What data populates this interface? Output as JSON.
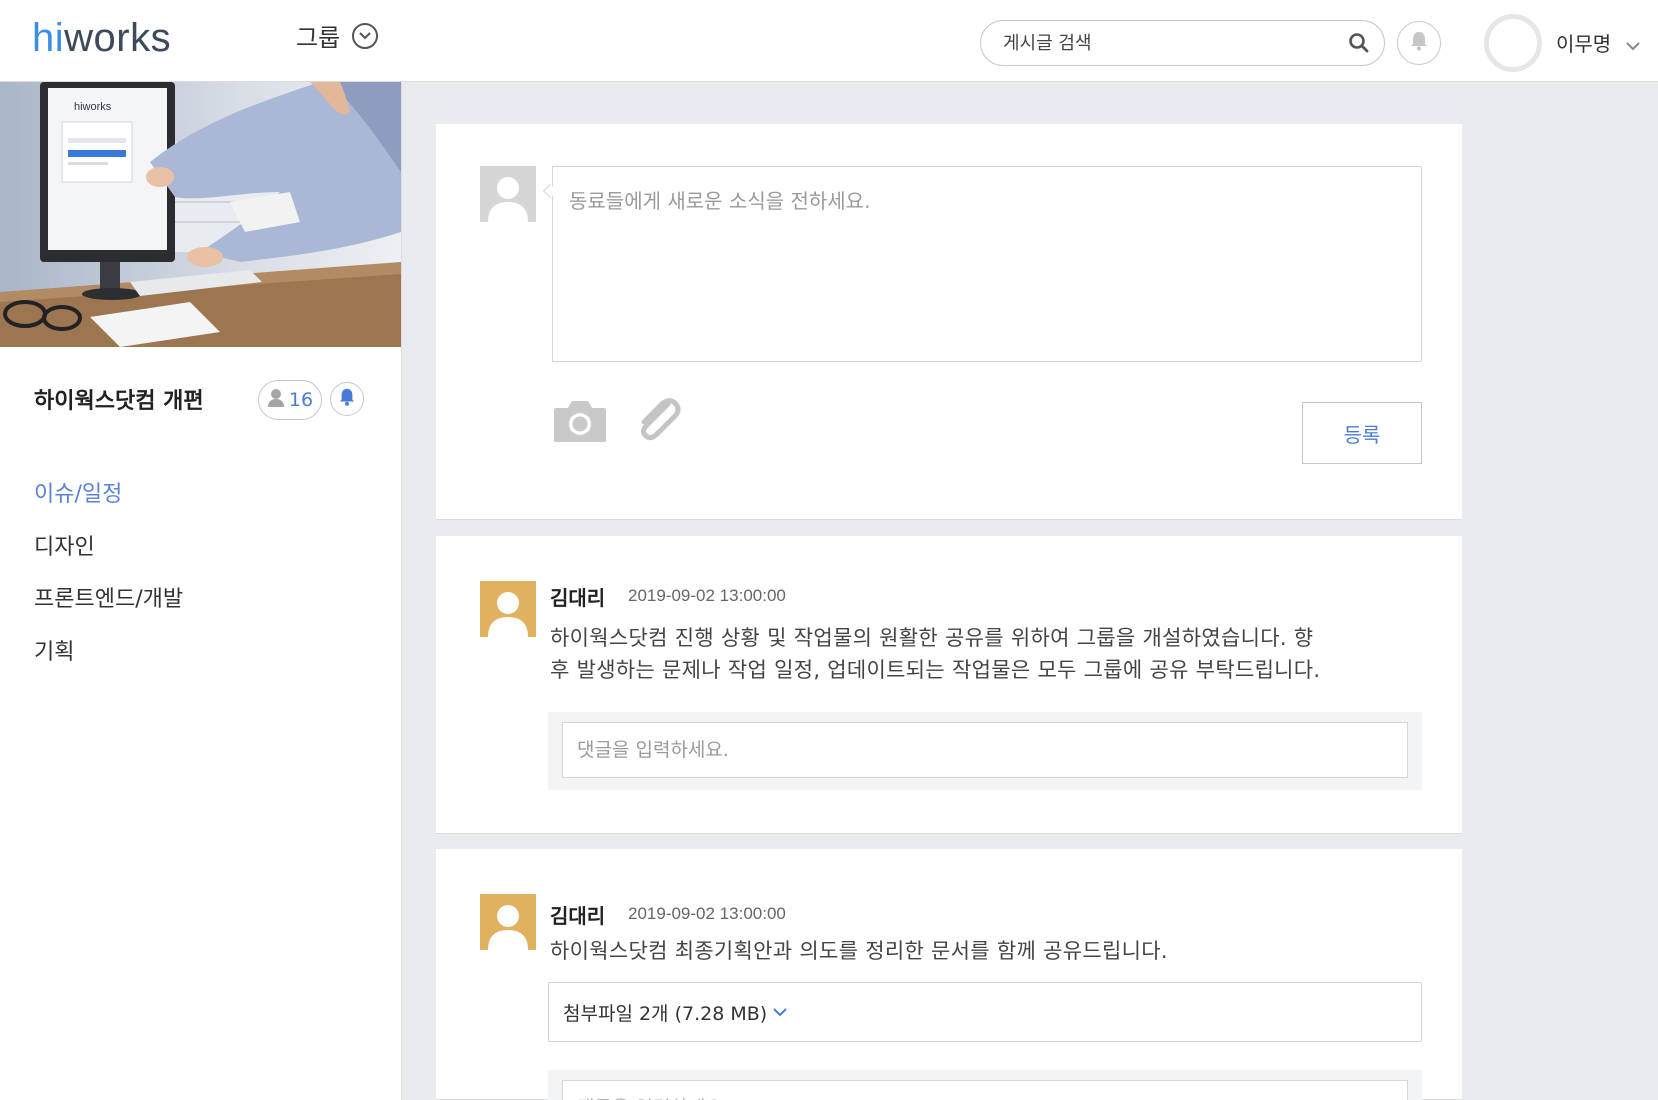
{
  "header": {
    "logo": {
      "h": "h",
      "i": "i",
      "rest": "works"
    },
    "group_menu_label": "그룹",
    "search_placeholder": "게시글 검색",
    "user_name": "이무명"
  },
  "sidebar": {
    "cover_logo": "hiworks",
    "group_title": "하이웍스닷컴 개편",
    "member_count": "16",
    "nav_items": [
      {
        "label": "이슈/일정",
        "active": true
      },
      {
        "label": "디자인",
        "active": false
      },
      {
        "label": "프론트엔드/개발",
        "active": false
      },
      {
        "label": "기획",
        "active": false
      }
    ]
  },
  "composer": {
    "placeholder": "동료들에게 새로운 소식을 전하세요.",
    "submit_label": "등록"
  },
  "posts": [
    {
      "author": "김대리",
      "time": "2019-09-02 13:00:00",
      "body_line1": "하이웍스닷컴 진행 상황 및 작업물의 원활한 공유를 위하여 그룹을 개설하였습니다. 향",
      "body_line2": "후 발생하는 문제나 작업 일정, 업데이트되는 작업물은 모두 그룹에 공유 부탁드립니다.",
      "comment_placeholder": "댓글을 입력하세요."
    },
    {
      "author": "김대리",
      "time": "2019-09-02 13:00:00",
      "body_line1": "하이웍스닷컴 최종기획안과 의도를 정리한 문서를 함께 공유드립니다.",
      "attachment_label": "첨부파일 2개 (7.28 MB)",
      "comment_placeholder": "댓글을 입력하세요."
    }
  ],
  "colors": {
    "accent": "#4a7bd8",
    "nav_active": "#5b82d8",
    "background": "#e9ebee",
    "avatar_gold": "#e0b15e"
  },
  "icons": [
    "chevron-down-icon",
    "search-icon",
    "bell-icon",
    "user-icon",
    "camera-icon",
    "paperclip-icon"
  ]
}
